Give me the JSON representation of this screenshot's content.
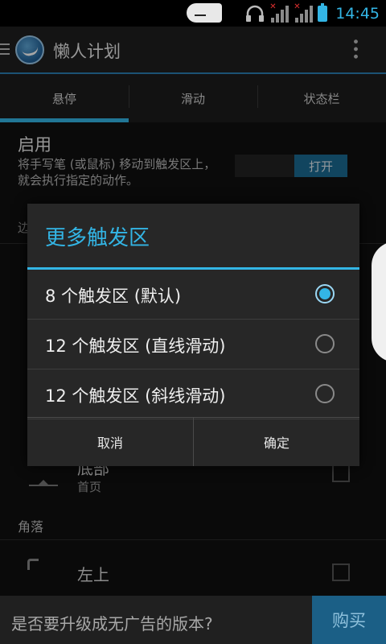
{
  "status_bar": {
    "time": "14:45",
    "icons": [
      "notification-icon",
      "headset-icon",
      "signal-icon",
      "signal-icon",
      "battery-icon"
    ]
  },
  "action_bar": {
    "title": "懒人计划",
    "icons": [
      "menu-icon",
      "app-logo",
      "overflow-icon"
    ]
  },
  "tabs": [
    {
      "label": "悬停",
      "active": true
    },
    {
      "label": "滑动",
      "active": false
    },
    {
      "label": "状态栏",
      "active": false
    }
  ],
  "background": {
    "enable_title": "启用",
    "enable_summary": "将手写笔 (或鼠标) 移动到触发区上，就会执行指定的动作。",
    "toggle_label": "打开",
    "edge_header": "边",
    "bottom_row": {
      "title": "底部",
      "subtitle": "首页"
    },
    "corner_header": "角落",
    "top_left_row": {
      "title": "左上"
    }
  },
  "dialog": {
    "title": "更多触发区",
    "options": [
      {
        "label": "8 个触发区 (默认)",
        "selected": true
      },
      {
        "label": "12 个触发区 (直线滑动)",
        "selected": false
      },
      {
        "label": "12 个触发区 (斜线滑动)",
        "selected": false
      }
    ],
    "cancel_label": "取消",
    "ok_label": "确定"
  },
  "ad_bar": {
    "text": "是否要升级成无广告的版本?",
    "buy_label": "购买"
  },
  "colors": {
    "accent": "#33b5e5",
    "dialog_bg": "#272727",
    "buy_button": "#1b5f86"
  }
}
